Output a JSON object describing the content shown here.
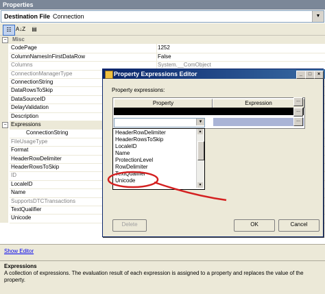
{
  "window": {
    "title": "Properties"
  },
  "object_selector": {
    "name": "Destination File",
    "type": "Connection"
  },
  "toolbar": {
    "categorized_icon": "categorized-icon",
    "alpha_icon": "alphabetical-icon",
    "pages_icon": "property-pages-icon",
    "alpha_text": "A↓Z"
  },
  "grid": {
    "category": "Misc",
    "category2": "Expressions",
    "rows": [
      {
        "name": "CodePage",
        "value": "1252"
      },
      {
        "name": "ColumnNamesInFirstDataRow",
        "value": "False"
      },
      {
        "name": "Columns",
        "value": "System.__ComObject"
      },
      {
        "name": "ConnectionManagerType",
        "value": ""
      },
      {
        "name": "ConnectionString",
        "value": ""
      },
      {
        "name": "DataRowsToSkip",
        "value": ""
      },
      {
        "name": "DataSourceID",
        "value": ""
      },
      {
        "name": "DelayValidation",
        "value": ""
      },
      {
        "name": "Description",
        "value": ""
      }
    ],
    "rows2": [
      {
        "name": "ConnectionString",
        "value": ""
      },
      {
        "name": "FileUsageType",
        "value": ""
      },
      {
        "name": "Format",
        "value": ""
      },
      {
        "name": "HeaderRowDelimiter",
        "value": ""
      },
      {
        "name": "HeaderRowsToSkip",
        "value": ""
      },
      {
        "name": "ID",
        "value": ""
      },
      {
        "name": "LocaleID",
        "value": ""
      },
      {
        "name": "Name",
        "value": ""
      },
      {
        "name": "SupportsDTCTransactions",
        "value": ""
      },
      {
        "name": "TextQualifier",
        "value": ""
      },
      {
        "name": "Unicode",
        "value": ""
      }
    ]
  },
  "commands": {
    "show_editor": "Show Editor"
  },
  "description": {
    "title": "Expressions",
    "text": "A collection of expressions. The evaluation result of each expression is assigned to a property and replaces the value of the property."
  },
  "dialog": {
    "title": "Property Expressions Editor",
    "label": "Property expressions:",
    "col_property": "Property",
    "col_expression": "Expression",
    "ellipsis": "...",
    "list_items": [
      "HeaderRowDelimiter",
      "HeaderRowsToSkip",
      "LocaleID",
      "Name",
      "ProtectionLevel",
      "RowDelimiter",
      "TextQualifier",
      "Unicode"
    ],
    "delete_label": "Delete",
    "ok_label": "OK",
    "cancel_label": "Cancel",
    "annotation_color": "#d42020"
  }
}
